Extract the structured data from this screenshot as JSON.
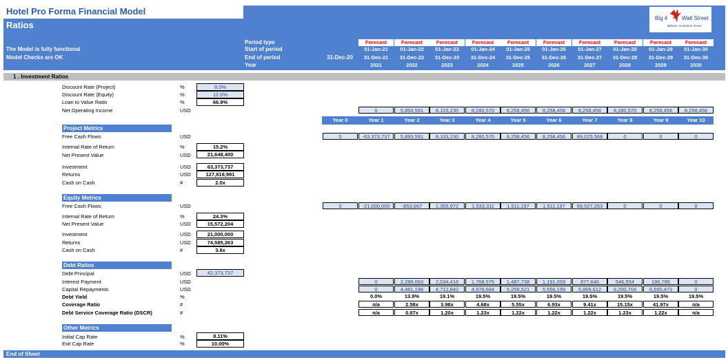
{
  "header": {
    "title": "Hotel Pro Forma Financial Model",
    "subtitle": "Ratios",
    "status_1": "The Model is fully functional",
    "status_2": "Model Checks are OK",
    "row_labels": [
      "Period type",
      "Start of period",
      "End of period",
      "Year"
    ],
    "base_end": "31-Dec-20",
    "periods": [
      {
        "type": "Forecast",
        "start": "01-Jan-21",
        "end": "31-Dec-21",
        "year": "2021"
      },
      {
        "type": "Forecast",
        "start": "01-Jan-22",
        "end": "31-Dec-22",
        "year": "2022"
      },
      {
        "type": "Forecast",
        "start": "01-Jan-23",
        "end": "31-Dec-23",
        "year": "2023"
      },
      {
        "type": "Forecast",
        "start": "01-Jan-24",
        "end": "31-Dec-24",
        "year": "2024"
      },
      {
        "type": "Forecast",
        "start": "01-Jan-25",
        "end": "31-Dec-25",
        "year": "2025"
      },
      {
        "type": "Forecast",
        "start": "01-Jan-26",
        "end": "31-Dec-26",
        "year": "2026"
      },
      {
        "type": "Forecast",
        "start": "01-Jan-27",
        "end": "31-Dec-27",
        "year": "2027"
      },
      {
        "type": "Forecast",
        "start": "01-Jan-28",
        "end": "31-Dec-28",
        "year": "2028"
      },
      {
        "type": "Forecast",
        "start": "01-Jan-29",
        "end": "31-Dec-29",
        "year": "2029"
      },
      {
        "type": "Forecast",
        "start": "01-Jan-30",
        "end": "31-Dec-30",
        "year": "2030"
      }
    ],
    "logo": {
      "line1": "Big 4",
      "line2": "Wall Street",
      "tagline": "Believe, Conceive, Excel"
    }
  },
  "section_title": "1 .  Investment Ratios",
  "inputs": [
    {
      "label": "Discount Rate (Project)",
      "unit": "%",
      "value": "8.0%"
    },
    {
      "label": "Discount Rate (Equity)",
      "unit": "%",
      "value": "12.0%"
    },
    {
      "label": "Loan to Value Ratio",
      "unit": "%",
      "value": "66.9%"
    }
  ],
  "noi": {
    "label": "Net Operating Income",
    "unit": "USD",
    "values": [
      "0",
      "5,893,591",
      "8,103,230",
      "8,280,570",
      "8,258,456",
      "8,258,456",
      "8,258,456",
      "8,280,570",
      "8,258,456",
      "8,258,456"
    ]
  },
  "year_headers": [
    "Year 0",
    "Year 1",
    "Year 2",
    "Year 3",
    "Year 4",
    "Year 5",
    "Year 6",
    "Year 7",
    "Year 8",
    "Year 9",
    "Year 10"
  ],
  "project": {
    "title": "Project Metrics",
    "fcf": {
      "label": "Free Cash Flows",
      "unit": "USD",
      "values": [
        "0",
        "-63,373,737",
        "5,893,591",
        "8,103,230",
        "8,280,570",
        "8,258,456",
        "8,258,456",
        "89,025,568",
        "0",
        "0",
        "0"
      ]
    },
    "irr": {
      "label": "Internal Rate of Return",
      "unit": "%",
      "value": "15.2%"
    },
    "npv": {
      "label": "Net Present Value",
      "unit": "USD",
      "value": "21,648,400"
    },
    "investment": {
      "label": "Investment",
      "unit": "USD",
      "value": "63,373,737"
    },
    "returns": {
      "label": "Returns",
      "unit": "USD",
      "value": "127,819,991"
    },
    "coc": {
      "label": "Cash on Cash",
      "unit": "#",
      "value": "2.0x"
    }
  },
  "equity": {
    "title": "Equity Metrics",
    "fcf": {
      "label": "Free Cash Flows",
      "unit": "USD",
      "values": [
        "0",
        "-21,000,000",
        "-853,667",
        "1,355,972",
        "1,533,311",
        "1,511,197",
        "1,511,197",
        "69,527,253",
        "0",
        "0",
        "0"
      ]
    },
    "irr": {
      "label": "Internal Rate of Return",
      "unit": "%",
      "value": "24.3%"
    },
    "npv": {
      "label": "Net Present Value",
      "unit": "USD",
      "value": "15,572,204"
    },
    "investment": {
      "label": "Investment",
      "unit": "USD",
      "value": "21,000,000"
    },
    "returns": {
      "label": "Returns",
      "unit": "USD",
      "value": "74,585,263"
    },
    "coc": {
      "label": "Cash on Cash",
      "unit": "#",
      "value": "3.6x"
    }
  },
  "debt": {
    "title": "Debt Ratios",
    "principal": {
      "label": "Debt Principal",
      "unit": "USD",
      "value": "42,373,737"
    },
    "interest": {
      "label": "Interest Payment",
      "unit": "USD",
      "values": [
        "0",
        "2,286,063",
        "2,034,416",
        "1,768,575",
        "1,487,738",
        "1,191,059",
        "877,646",
        "546,554",
        "196,785",
        "0"
      ]
    },
    "repay": {
      "label": "Capital Repayments",
      "unit": "USD",
      "values": [
        "0",
        "4,461,196",
        "4,712,842",
        "4,978,684",
        "5,259,521",
        "5,556,199",
        "5,869,612",
        "6,200,704",
        "6,550,473",
        "0"
      ]
    },
    "yield": {
      "label": "Debt Yield",
      "unit": "%",
      "values": [
        "0.0%",
        "13.9%",
        "19.1%",
        "19.5%",
        "19.5%",
        "19.5%",
        "19.5%",
        "19.5%",
        "19.5%",
        "19.5%"
      ]
    },
    "coverage": {
      "label": "Coverage Ratio",
      "unit": "#",
      "values": [
        "n/a",
        "2.58x",
        "3.98x",
        "4.68x",
        "5.55x",
        "6.93x",
        "9.41x",
        "15.15x",
        "41.97x",
        "n/a"
      ]
    },
    "dscr": {
      "label": "Debt Service Coverage Ratio (DSCR)",
      "unit": "#",
      "values": [
        "n/a",
        "0.87x",
        "1.20x",
        "1.23x",
        "1.22x",
        "1.22x",
        "1.22x",
        "1.23x",
        "1.22x",
        "n/a"
      ]
    }
  },
  "other": {
    "title": "Other Metrics",
    "initial_cap": {
      "label": "Initial Cap Rate",
      "unit": "%",
      "value": "8.11%"
    },
    "exit_cap": {
      "label": "Exit Cap Rate",
      "unit": "%",
      "value": "10.00%"
    }
  },
  "footer": "End of Sheet",
  "colors": {
    "header_blue": "#4f81d0",
    "forecast_red": "#ff0000",
    "input_fill": "#dbe5f1",
    "input_text": "#2a3f9c",
    "section_grey": "#bfbfbf"
  }
}
